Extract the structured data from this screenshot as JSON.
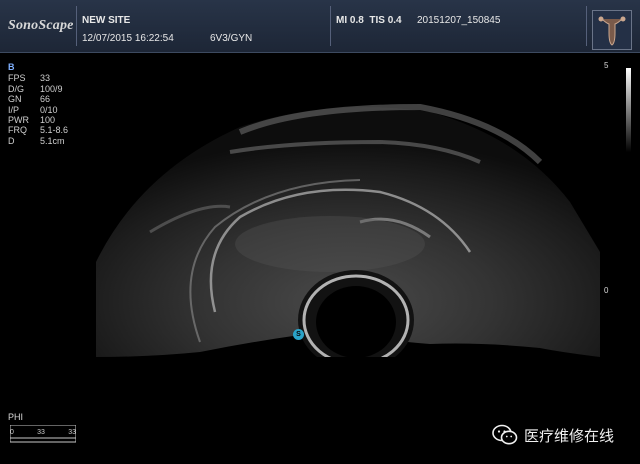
{
  "header": {
    "brand": "SonoScape",
    "site": "NEW SITE",
    "datetime": "12/07/2015 16:22:54",
    "probe_preset": "6V3/GYN",
    "mi": "MI  0.8",
    "tis": "TIS  0.4",
    "study_id": "20151207_150845"
  },
  "params": {
    "mode": "B",
    "rows": [
      {
        "k": "FPS",
        "v": "33"
      },
      {
        "k": "D/G",
        "v": "100/9"
      },
      {
        "k": "GN",
        "v": "66"
      },
      {
        "k": "I/P",
        "v": "0/10"
      },
      {
        "k": "PWR",
        "v": "100"
      },
      {
        "k": "FRQ",
        "v": "5.1-8.6"
      },
      {
        "k": "D",
        "v": "5.1cm"
      }
    ]
  },
  "scale": {
    "top": "5",
    "zero": "0"
  },
  "focus_marker": "S",
  "phi": {
    "label": "PHI",
    "ticks": [
      "0",
      "33",
      "33"
    ]
  },
  "watermark": {
    "text": "医疗维修在线"
  },
  "colors": {
    "header_bg": "#1d2636",
    "mode": "#7fb0ff",
    "marker": "#2aa3c8"
  },
  "icons": [
    "wechat-icon"
  ]
}
